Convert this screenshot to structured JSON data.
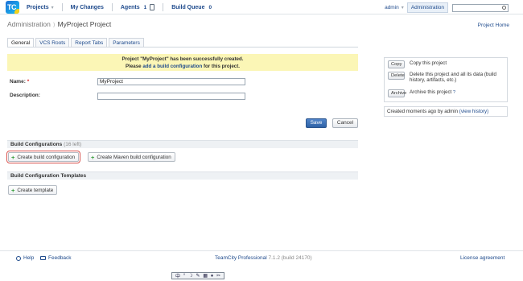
{
  "header": {
    "logo_text": "TC",
    "nav": [
      {
        "label": "Projects",
        "has_menu": true
      },
      {
        "label": "My Changes",
        "has_menu": false
      },
      {
        "label": "Agents",
        "count": "1"
      },
      {
        "label": "Build Queue",
        "count": "0"
      }
    ],
    "user": "admin",
    "admin_tab": "Administration",
    "search": {
      "value": "",
      "placeholder": ""
    }
  },
  "breadcrumb": {
    "parent": "Administration",
    "current": "MyProject Project"
  },
  "project_home_link": "Project Home",
  "tabs": [
    "General",
    "VCS Roots",
    "Report Tabs",
    "Parameters"
  ],
  "message": {
    "line1": "Project \"MyProject\" has been successfully created.",
    "line2_pre": "Please ",
    "line2_link": "add a build configuration",
    "line2_post": " for this project."
  },
  "form": {
    "name_label": "Name:",
    "name_required": "*",
    "name_value": "MyProject",
    "description_label": "Description:",
    "description_value": "",
    "save_label": "Save",
    "cancel_label": "Cancel"
  },
  "build_configurations": {
    "title": "Build Configurations",
    "note": "(16 left)",
    "create_label": "Create build configuration",
    "create_maven_label": "Create Maven build configuration"
  },
  "templates": {
    "title": "Build Configuration Templates",
    "create_label": "Create template"
  },
  "actions": [
    {
      "button": "Copy",
      "text": "Copy this project"
    },
    {
      "button": "Delete",
      "text": "Delete this project and all its data (build history, artifacts, etc.)"
    },
    {
      "button": "Archive",
      "text": "Archive this project",
      "help": "?"
    }
  ],
  "created_info": {
    "text": "Created moments ago by admin ",
    "link": "(view history)"
  },
  "footer": {
    "help": "Help",
    "feedback": "Feedback",
    "product": "TeamCity Professional",
    "version": "7.1.2",
    "build": "(build 24170)",
    "license": "License agreement"
  },
  "ime_bar": [
    "中",
    "°",
    "☽",
    "✎",
    "▦",
    "♦",
    "✂"
  ]
}
